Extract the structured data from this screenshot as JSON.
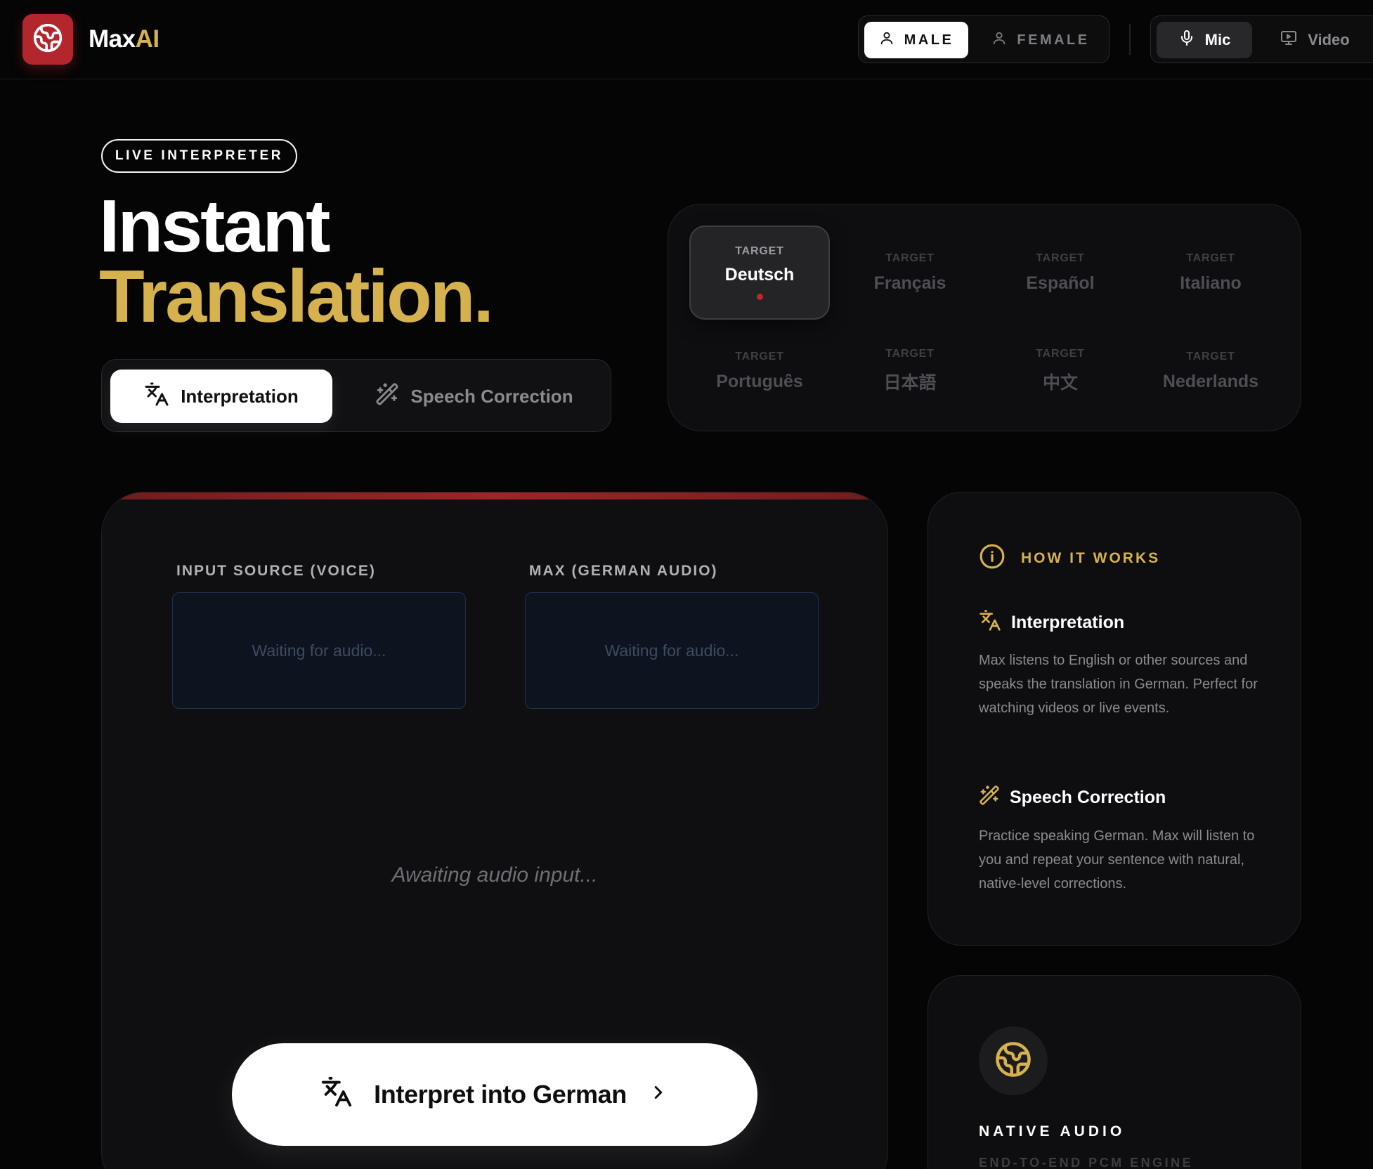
{
  "header": {
    "brand_main": "Max",
    "brand_accent": "AI",
    "voice_options": [
      {
        "label": "MALE",
        "selected": true
      },
      {
        "label": "FEMALE",
        "selected": false
      }
    ],
    "input_options": [
      {
        "label": "Mic",
        "selected": true
      },
      {
        "label": "Video",
        "selected": false
      }
    ]
  },
  "hero": {
    "badge": "LIVE INTERPRETER",
    "title_line1": "Instant",
    "title_line2": "Translation.",
    "modes": [
      {
        "label": "Interpretation",
        "selected": true
      },
      {
        "label": "Speech Correction",
        "selected": false
      }
    ]
  },
  "languages": [
    {
      "tag": "TARGET",
      "name": "Deutsch",
      "selected": true
    },
    {
      "tag": "TARGET",
      "name": "Français",
      "selected": false
    },
    {
      "tag": "TARGET",
      "name": "Español",
      "selected": false
    },
    {
      "tag": "TARGET",
      "name": "Italiano",
      "selected": false
    },
    {
      "tag": "TARGET",
      "name": "Português",
      "selected": false
    },
    {
      "tag": "TARGET",
      "name": "日本語",
      "selected": false
    },
    {
      "tag": "TARGET",
      "name": "中文",
      "selected": false
    },
    {
      "tag": "TARGET",
      "name": "Nederlands",
      "selected": false
    }
  ],
  "main_panel": {
    "input_label": "INPUT SOURCE (VOICE)",
    "input_placeholder": "Waiting for audio...",
    "output_label": "MAX (GERMAN AUDIO)",
    "output_placeholder": "Waiting for audio...",
    "status": "Awaiting audio input...",
    "cta_label": "Interpret into German"
  },
  "how_it_works": {
    "title": "HOW IT WORKS",
    "features": [
      {
        "title": "Interpretation",
        "description": "Max listens to English or other sources and speaks the translation in German. Perfect for watching videos or live events."
      },
      {
        "title": "Speech Correction",
        "description": "Practice speaking German. Max will listen to you and repeat your sentence with natural, native-level corrections."
      }
    ]
  },
  "native_audio": {
    "title": "NATIVE AUDIO",
    "subtitle": "END-TO-END PCM ENGINE"
  },
  "colors": {
    "background": "#050505",
    "brand_red": "#b3262d",
    "accent_gold": "#d6b24e",
    "panel": "#0f0f11"
  },
  "icons": {
    "logo": "globe-icon",
    "male": "user-icon",
    "female": "user-icon",
    "mic": "microphone-icon",
    "video": "monitor-play-icon",
    "interpretation": "translate-icon",
    "speech_correction": "magic-wand-icon",
    "how_it_works": "info-icon",
    "cta_arrow": "chevron-right-icon",
    "native_audio": "globe-icon"
  }
}
